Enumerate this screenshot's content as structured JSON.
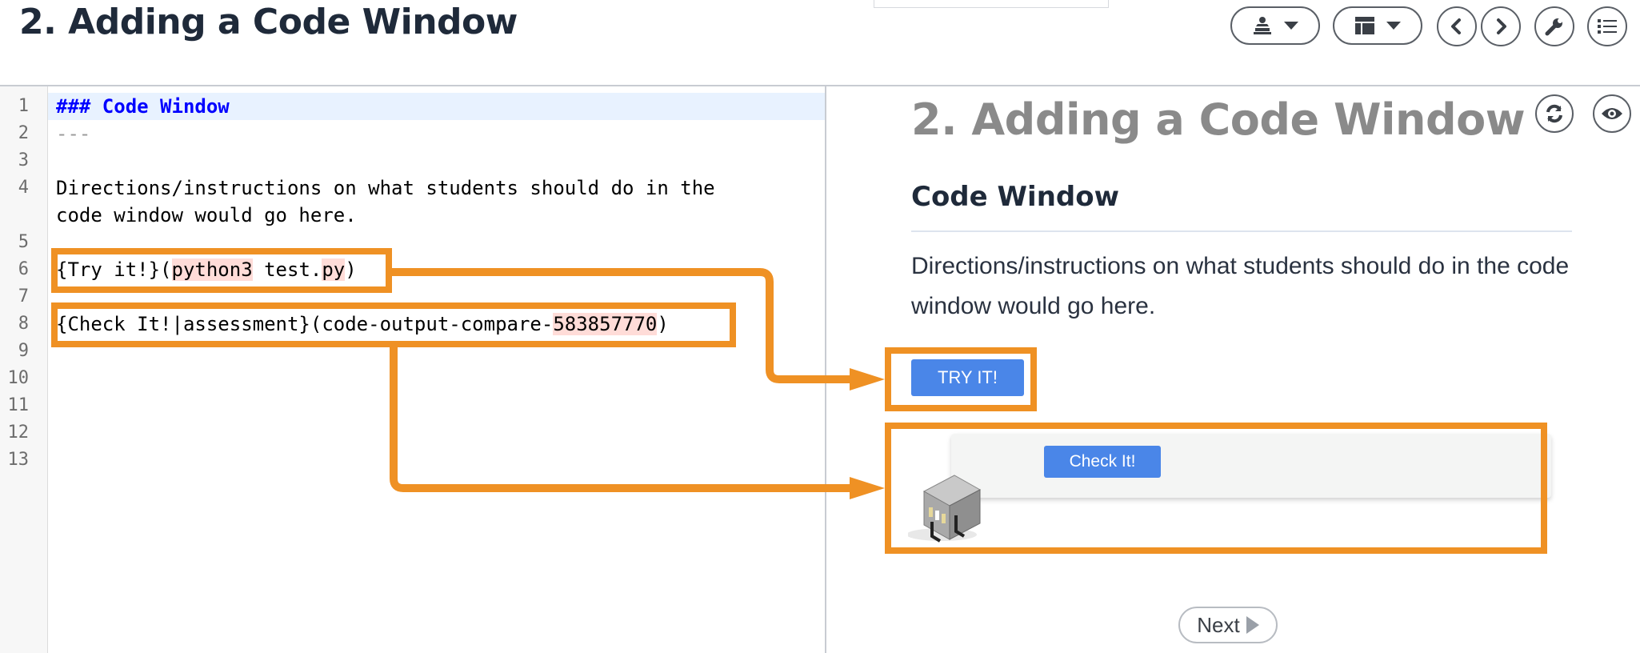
{
  "header": {
    "title": "2. Adding a Code Window"
  },
  "toolbar": {
    "items": [
      {
        "icon": "presenter-icon",
        "has_dropdown": true
      },
      {
        "icon": "layout-icon",
        "has_dropdown": true
      },
      {
        "icon": "chevron-left-icon"
      },
      {
        "icon": "chevron-right-icon"
      },
      {
        "icon": "wrench-icon"
      },
      {
        "icon": "list-icon"
      }
    ]
  },
  "editor": {
    "line_numbers": [
      "1",
      "2",
      "3",
      "4",
      "5",
      "6",
      "7",
      "8",
      "9",
      "10",
      "11",
      "12",
      "13"
    ],
    "lines": {
      "l1": "### Code Window",
      "l2": "---",
      "l4a": "Directions/instructions on what students should do in the",
      "l4b": "code window would go here.",
      "l6_pre": "{Try it!}(",
      "l6_hl": "python3",
      "l6_mid": " test.",
      "l6_hl2": "py",
      "l6_post": ")",
      "l8_pre": "{Check It!|assessment}(code-output-compare-",
      "l8_hl": "583857770",
      "l8_post": ")"
    }
  },
  "preview": {
    "title": "2. Adding a Code Window",
    "section_heading": "Code Window",
    "body": "Directions/instructions on what students should do in the code window would go here.",
    "try_button": "TRY IT!",
    "check_button": "Check It!",
    "next_button": "Next",
    "icons": [
      "refresh-icon",
      "eye-icon"
    ]
  },
  "annotation": {
    "color": "#ef9124"
  },
  "colors": {
    "button_blue": "#4a86e8",
    "heading_blue": "#0000ff",
    "title_gray": "#8a8a8a"
  }
}
